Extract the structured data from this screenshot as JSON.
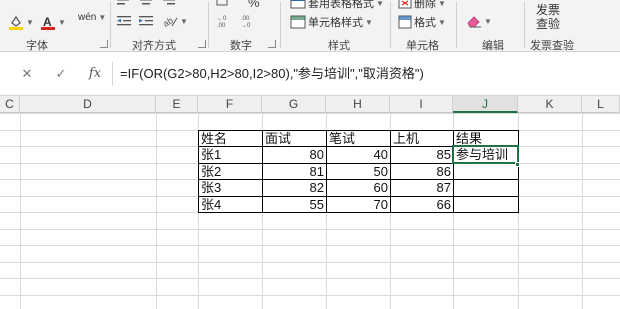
{
  "ribbon": {
    "font_group": {
      "label": "字体",
      "wen_label": "wén"
    },
    "alignment_group": {
      "label": "对齐方式"
    },
    "number_group": {
      "label": "数字",
      "percent_symbol": "%"
    },
    "styles_group": {
      "label": "样式",
      "table_format_label": "套用表格格式",
      "cell_styles_label": "单元格样式"
    },
    "cells_group": {
      "label": "单元格",
      "delete_label": "删除",
      "format_label": "格式"
    },
    "editing_group": {
      "label": "编辑"
    },
    "invoice_group": {
      "label": "发票查验",
      "button_line1": "发票",
      "button_line2": "查验"
    }
  },
  "formula_bar": {
    "cancel_symbol": "✕",
    "enter_symbol": "✓",
    "fx_label": "fx",
    "formula": "=IF(OR(G2>80,H2>80,I2>80),\"参与培训\",\"取消资格\")"
  },
  "columns": [
    "C",
    "D",
    "E",
    "F",
    "G",
    "H",
    "I",
    "J",
    "K",
    "L"
  ],
  "active_column": "J",
  "table": {
    "headers": [
      "姓名",
      "面试",
      "笔试",
      "上机",
      "结果"
    ],
    "rows": [
      {
        "name": "张1",
        "interview": "80",
        "written": "40",
        "computer": "85",
        "result": "参与培训"
      },
      {
        "name": "张2",
        "interview": "81",
        "written": "50",
        "computer": "86",
        "result": ""
      },
      {
        "name": "张3",
        "interview": "82",
        "written": "60",
        "computer": "87",
        "result": ""
      },
      {
        "name": "张4",
        "interview": "55",
        "written": "70",
        "computer": "66",
        "result": ""
      }
    ]
  },
  "colors": {
    "accent_green": "#217346",
    "font_color_red": "#d9261c",
    "fill_color_yellow": "#ffd400"
  }
}
